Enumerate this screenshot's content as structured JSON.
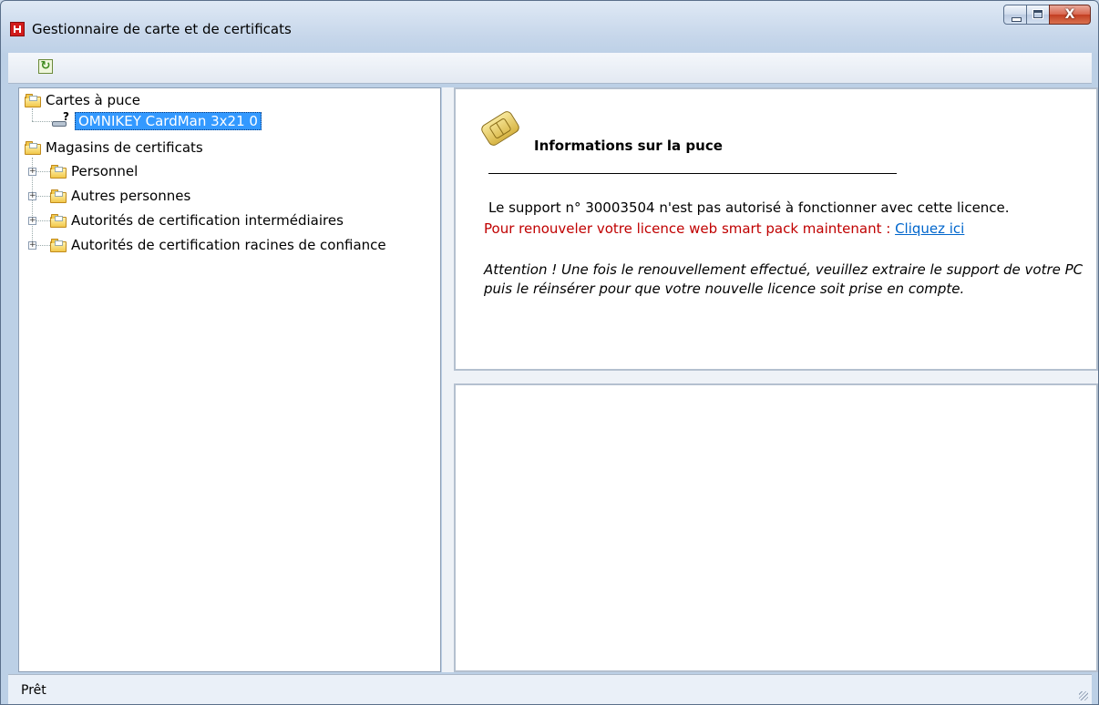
{
  "window": {
    "title": "Gestionnaire de carte et de certificats"
  },
  "tree": {
    "smartcards_label": "Cartes à puce",
    "reader_label": "OMNIKEY CardMan 3x21 0",
    "stores_label": "Magasins de certificats",
    "stores": [
      {
        "label": "Personnel"
      },
      {
        "label": "Autres personnes"
      },
      {
        "label": "Autorités de certification intermédiaires"
      },
      {
        "label": "Autorités de certification racines de confiance"
      }
    ]
  },
  "info": {
    "title": "Informations sur la puce",
    "message": "Le support n° 30003504 n'est pas autorisé à fonctionner avec cette licence.",
    "renew_text": "Pour renouveler votre licence web smart pack maintenant : ",
    "renew_link": "Cliquez ici",
    "note": "Attention ! Une fois le renouvellement effectué, veuillez extraire le support de votre PC puis le réinsérer pour que votre nouvelle licence soit prise en  compte."
  },
  "status": {
    "text": "Prêt"
  },
  "colors": {
    "warning_text": "#c00000",
    "link": "#0066cc",
    "selection": "#3399ff"
  }
}
